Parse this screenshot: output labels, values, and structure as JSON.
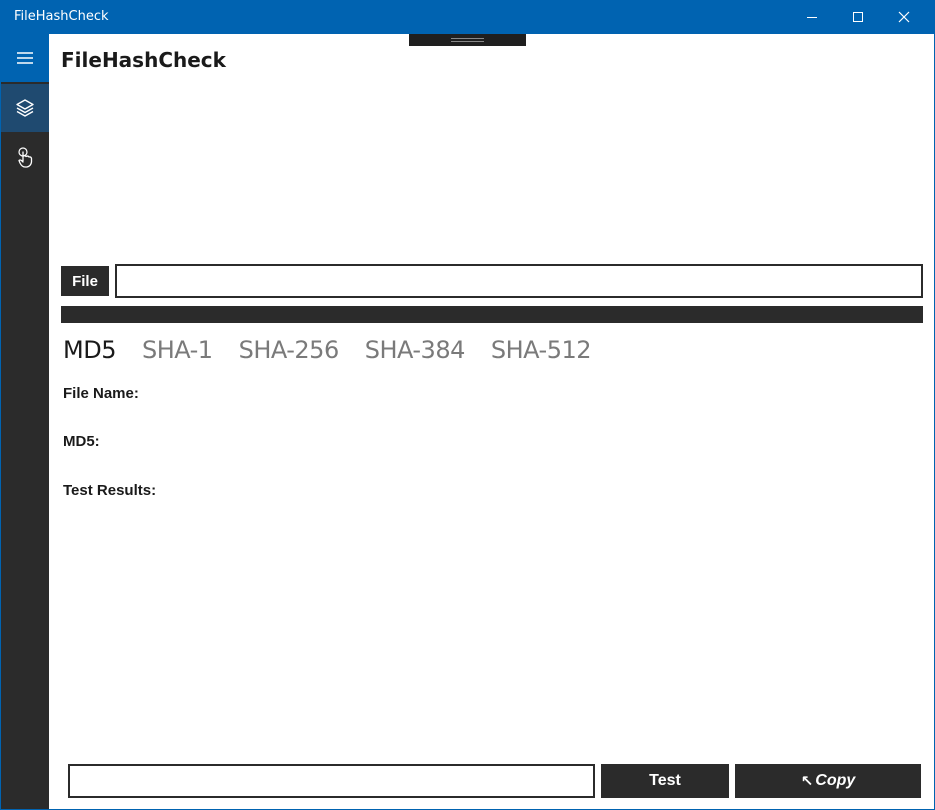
{
  "window": {
    "title": "FileHashCheck"
  },
  "sidebar": {
    "items": [
      {
        "icon": "hamburger-menu-icon"
      },
      {
        "icon": "layers-icon"
      },
      {
        "icon": "touch-hand-icon"
      }
    ]
  },
  "page": {
    "title": "FileHashCheck"
  },
  "file": {
    "button_label": "File",
    "path_value": "",
    "progress": 0
  },
  "tabs": [
    {
      "label": "MD5",
      "active": true
    },
    {
      "label": "SHA-1",
      "active": false
    },
    {
      "label": "SHA-256",
      "active": false
    },
    {
      "label": "SHA-384",
      "active": false
    },
    {
      "label": "SHA-512",
      "active": false
    }
  ],
  "fields": {
    "file_name_label": "File Name:",
    "hash_label": "MD5:",
    "test_results_label": "Test Results:"
  },
  "bottom": {
    "input_value": "",
    "test_label": "Test",
    "copy_arrow": "↖",
    "copy_label": "Copy"
  },
  "colors": {
    "accent": "#0063b1",
    "dark": "#2b2b2b",
    "inactive_tab": "#7a7a7a"
  }
}
